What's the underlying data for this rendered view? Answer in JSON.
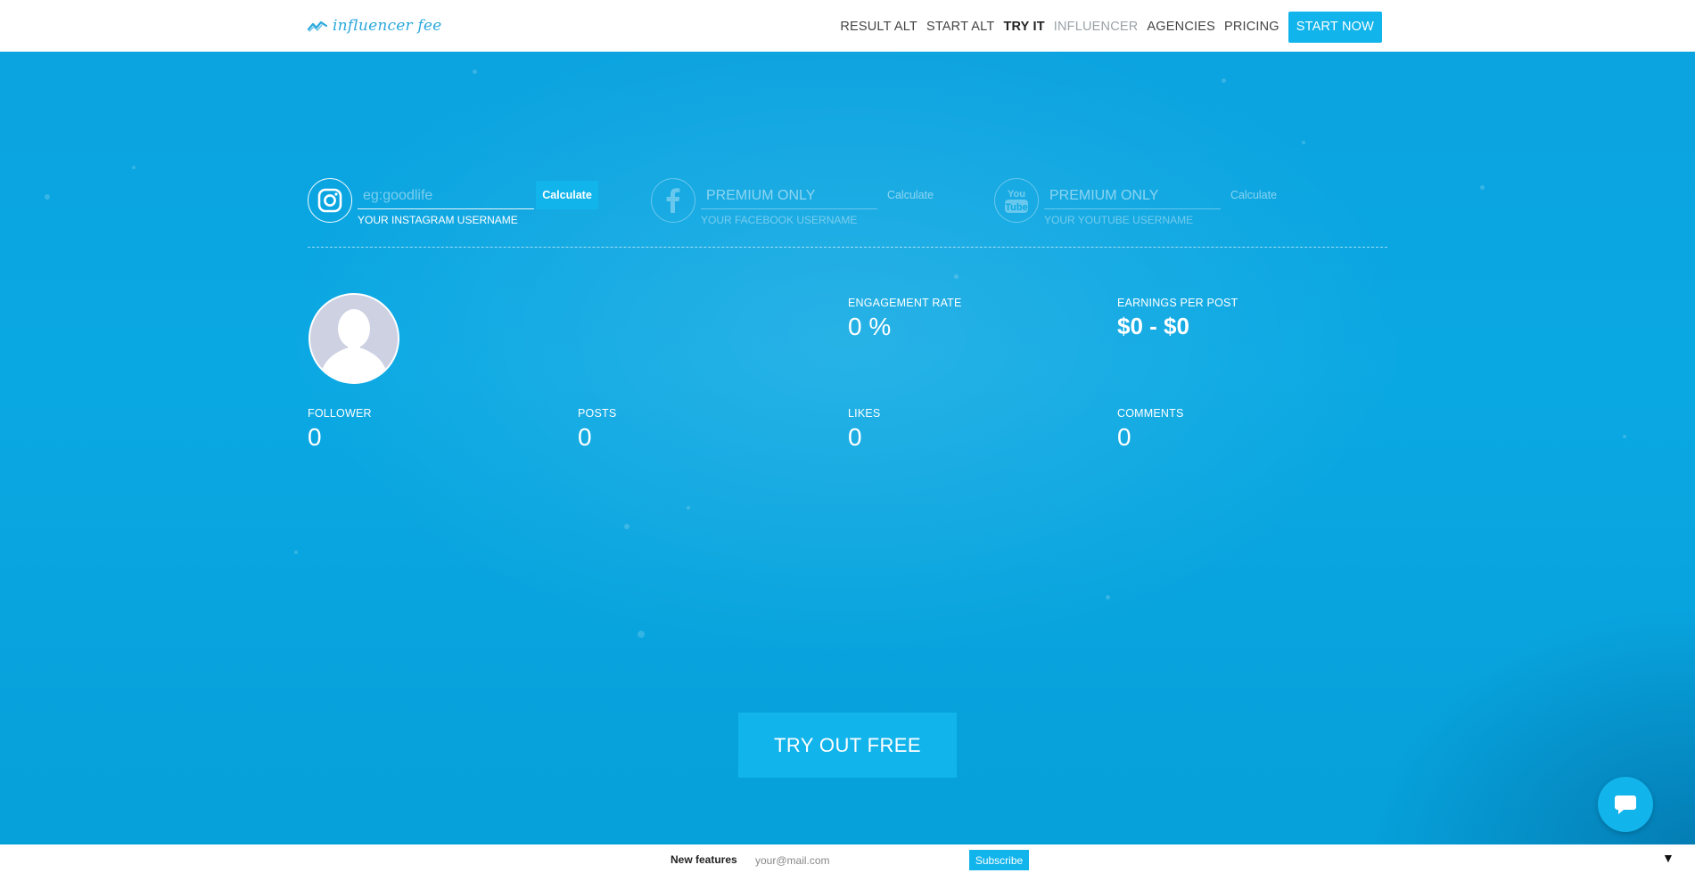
{
  "header": {
    "logo_text": "influencer fee",
    "nav": [
      {
        "label": "RESULT ALT"
      },
      {
        "label": "START ALT"
      },
      {
        "label": "TRY IT"
      },
      {
        "label": "INFLUENCER"
      },
      {
        "label": "AGENCIES"
      },
      {
        "label": "PRICING"
      }
    ],
    "cta_label": "START NOW"
  },
  "search": {
    "instagram": {
      "placeholder": "eg:goodlife",
      "button": "Calculate",
      "label": "YOUR INSTAGRAM USERNAME",
      "icon": "instagram-icon"
    },
    "facebook": {
      "placeholder": "PREMIUM ONLY",
      "button": "Calculate",
      "label": "YOUR FACEBOOK USERNAME",
      "icon": "facebook-icon"
    },
    "youtube": {
      "placeholder": "PREMIUM ONLY",
      "button": "Calculate",
      "label": "YOUR YOUTUBE USERNAME",
      "icon": "youtube-icon"
    }
  },
  "stats": {
    "engagement": {
      "label": "ENGAGEMENT RATE",
      "value": "0 %"
    },
    "earnings": {
      "label": "EARNINGS PER POST",
      "value": "$0 - $0"
    },
    "follower": {
      "label": "FOLLOWER",
      "value": "0"
    },
    "posts": {
      "label": "POSTS",
      "value": "0"
    },
    "likes": {
      "label": "LIKES",
      "value": "0"
    },
    "comments": {
      "label": "COMMENTS",
      "value": "0"
    }
  },
  "try_button": "TRY OUT FREE",
  "chat_icon": "chat-bubble-icon",
  "footer": {
    "label": "New features",
    "email_placeholder": "your@mail.com",
    "subscribe": "Subscribe",
    "toggle": "▼"
  },
  "colors": {
    "accent": "#12b4ec",
    "hero": "#0aa8e3"
  }
}
